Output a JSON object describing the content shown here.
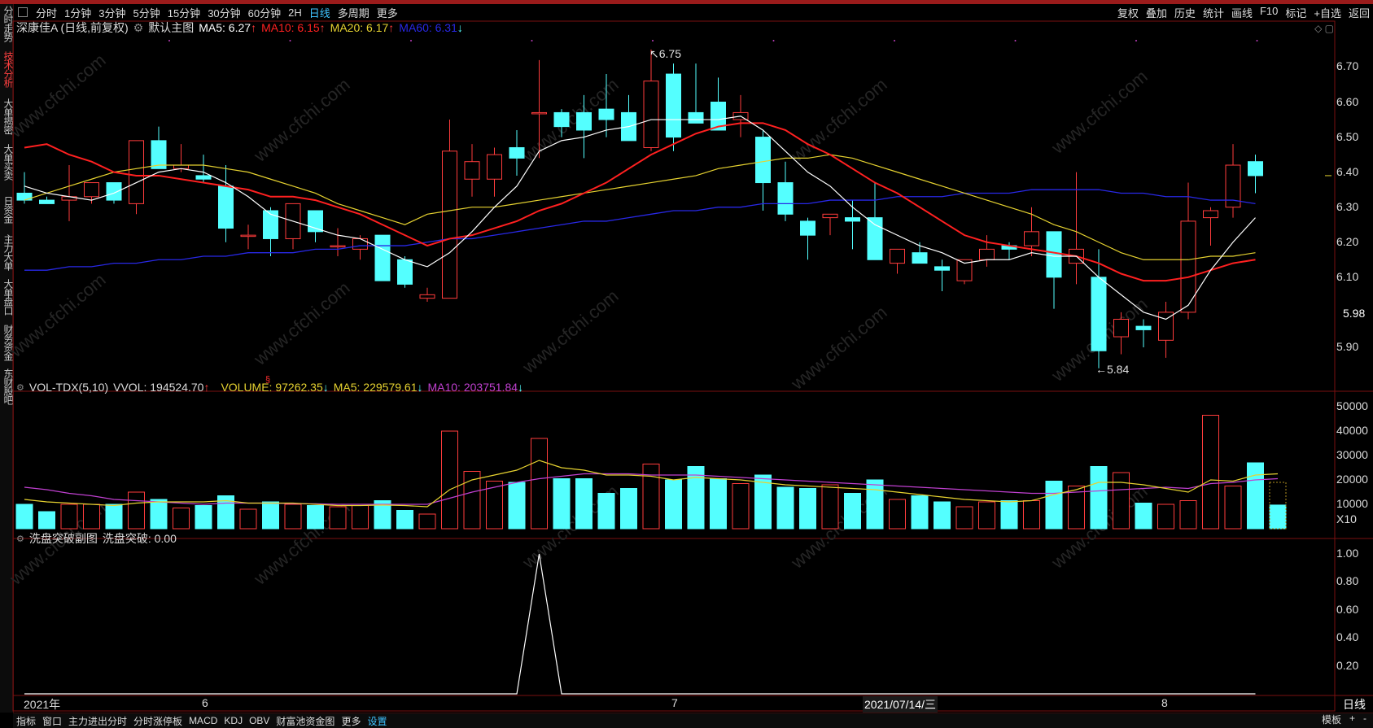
{
  "period_tabs": [
    "分时",
    "1分钟",
    "3分钟",
    "5分钟",
    "15分钟",
    "30分钟",
    "60分钟",
    "2H",
    "日线",
    "多周期",
    "更多"
  ],
  "active_period": "日线",
  "toolbar": [
    "复权",
    "叠加",
    "历史",
    "统计",
    "画线",
    "F10",
    "标记",
    "+自选",
    "返回"
  ],
  "sidebar_tabs": [
    "分时走势",
    "技术分析",
    "大单揭密",
    "大单买卖",
    "日资金",
    "主力大单",
    "大单盘口",
    "财务资金",
    "东财股吧"
  ],
  "active_sidebar": "技术分析",
  "main_legend": {
    "stock": "深康佳A (日线,前复权)",
    "template": "默认主图",
    "ma5": "MA5: 6.27",
    "ma10": "MA10: 6.15",
    "ma20": "MA20: 6.17",
    "ma60": "MA60: 6.31"
  },
  "vol_legend": {
    "name": "VOL-TDX(5,10)",
    "vvol": "VVOL: 194524.70",
    "volume": "VOLUME: 97262.35",
    "ma5": "MA5: 229579.61",
    "ma10": "MA10: 203751.84"
  },
  "ind_legend": {
    "name": "洗盘突破副图",
    "value": "洗盘突破: 0.00"
  },
  "price_axis": [
    "6.70",
    "6.60",
    "6.50",
    "6.40",
    "6.30",
    "6.20",
    "6.10",
    "5.90"
  ],
  "current_price": "5.98",
  "high_label": "6.75",
  "low_label": "5.84",
  "vol_axis": [
    "50000",
    "40000",
    "30000",
    "20000",
    "10000",
    "X10"
  ],
  "ind_axis": [
    "1.00",
    "0.80",
    "0.60",
    "0.40",
    "0.20"
  ],
  "dates": {
    "year": "2021年",
    "m6": "6",
    "m7": "7",
    "cursor": "2021/07/14/三",
    "m8": "8"
  },
  "period_corner": "日线",
  "bottom_tabs": [
    "指标",
    "窗口",
    "主力进出分时",
    "分时涨停板",
    "MACD",
    "KDJ",
    "OBV",
    "财富池资金图",
    "更多",
    "设置"
  ],
  "active_bottom": "设置",
  "bottom_right": [
    "模板",
    "+",
    "-"
  ],
  "watermark": "www.cfchi.com",
  "colors": {
    "up": "#ff3c3c",
    "down": "#54ffff",
    "ma5": "#ffffff",
    "ma10": "#ff2020",
    "ma20": "#e6d230",
    "ma60": "#2828e6",
    "vma10": "#c040d0"
  },
  "chart_data": {
    "type": "candlestick",
    "ylim": [
      5.8,
      6.78
    ],
    "candles": [
      {
        "o": 6.34,
        "h": 6.4,
        "l": 6.31,
        "c": 6.32
      },
      {
        "o": 6.32,
        "h": 6.33,
        "l": 6.31,
        "c": 6.31
      },
      {
        "o": 6.32,
        "h": 6.42,
        "l": 6.26,
        "c": 6.33
      },
      {
        "o": 6.33,
        "h": 6.37,
        "l": 6.31,
        "c": 6.37
      },
      {
        "o": 6.37,
        "h": 6.37,
        "l": 6.31,
        "c": 6.32
      },
      {
        "o": 6.31,
        "h": 6.45,
        "l": 6.28,
        "c": 6.49
      },
      {
        "o": 6.49,
        "h": 6.53,
        "l": 6.41,
        "c": 6.41
      },
      {
        "o": 6.41,
        "h": 6.48,
        "l": 6.4,
        "c": 6.42
      },
      {
        "o": 6.39,
        "h": 6.45,
        "l": 6.37,
        "c": 6.38
      },
      {
        "o": 6.36,
        "h": 6.42,
        "l": 6.2,
        "c": 6.24
      },
      {
        "o": 6.22,
        "h": 6.25,
        "l": 6.18,
        "c": 6.22
      },
      {
        "o": 6.29,
        "h": 6.3,
        "l": 6.16,
        "c": 6.21
      },
      {
        "o": 6.21,
        "h": 6.3,
        "l": 6.18,
        "c": 6.31
      },
      {
        "o": 6.29,
        "h": 6.29,
        "l": 6.2,
        "c": 6.23
      },
      {
        "o": 6.19,
        "h": 6.24,
        "l": 6.16,
        "c": 6.19
      },
      {
        "o": 6.18,
        "h": 6.22,
        "l": 6.15,
        "c": 6.21
      },
      {
        "o": 6.22,
        "h": 6.22,
        "l": 6.09,
        "c": 6.09
      },
      {
        "o": 6.15,
        "h": 6.16,
        "l": 6.07,
        "c": 6.08
      },
      {
        "o": 6.04,
        "h": 6.07,
        "l": 6.03,
        "c": 6.05
      },
      {
        "o": 6.04,
        "h": 6.55,
        "l": 6.04,
        "c": 6.46
      },
      {
        "o": 6.38,
        "h": 6.48,
        "l": 6.33,
        "c": 6.43
      },
      {
        "o": 6.38,
        "h": 6.47,
        "l": 6.33,
        "c": 6.45
      },
      {
        "o": 6.47,
        "h": 6.52,
        "l": 6.39,
        "c": 6.44
      },
      {
        "o": 6.57,
        "h": 6.72,
        "l": 6.44,
        "c": 6.57
      },
      {
        "o": 6.57,
        "h": 6.58,
        "l": 6.5,
        "c": 6.53
      },
      {
        "o": 6.57,
        "h": 6.62,
        "l": 6.44,
        "c": 6.52
      },
      {
        "o": 6.58,
        "h": 6.68,
        "l": 6.5,
        "c": 6.55
      },
      {
        "o": 6.57,
        "h": 6.62,
        "l": 6.52,
        "c": 6.49
      },
      {
        "o": 6.47,
        "h": 6.75,
        "l": 6.46,
        "c": 6.66
      },
      {
        "o": 6.68,
        "h": 6.71,
        "l": 6.46,
        "c": 6.5
      },
      {
        "o": 6.57,
        "h": 6.71,
        "l": 6.56,
        "c": 6.54
      },
      {
        "o": 6.6,
        "h": 6.67,
        "l": 6.52,
        "c": 6.52
      },
      {
        "o": 6.55,
        "h": 6.62,
        "l": 6.5,
        "c": 6.57
      },
      {
        "o": 6.5,
        "h": 6.52,
        "l": 6.29,
        "c": 6.37
      },
      {
        "o": 6.37,
        "h": 6.43,
        "l": 6.26,
        "c": 6.28
      },
      {
        "o": 6.26,
        "h": 6.27,
        "l": 6.15,
        "c": 6.22
      },
      {
        "o": 6.27,
        "h": 6.27,
        "l": 6.22,
        "c": 6.28
      },
      {
        "o": 6.27,
        "h": 6.32,
        "l": 6.18,
        "c": 6.26
      },
      {
        "o": 6.27,
        "h": 6.37,
        "l": 6.15,
        "c": 6.15
      },
      {
        "o": 6.14,
        "h": 6.17,
        "l": 6.11,
        "c": 6.18
      },
      {
        "o": 6.17,
        "h": 6.2,
        "l": 6.14,
        "c": 6.14
      },
      {
        "o": 6.13,
        "h": 6.15,
        "l": 6.06,
        "c": 6.12
      },
      {
        "o": 6.09,
        "h": 6.15,
        "l": 6.08,
        "c": 6.15
      },
      {
        "o": 6.15,
        "h": 6.22,
        "l": 6.13,
        "c": 6.18
      },
      {
        "o": 6.19,
        "h": 6.2,
        "l": 6.15,
        "c": 6.18
      },
      {
        "o": 6.19,
        "h": 6.3,
        "l": 6.16,
        "c": 6.23
      },
      {
        "o": 6.23,
        "h": 6.23,
        "l": 6.01,
        "c": 6.1
      },
      {
        "o": 6.14,
        "h": 6.4,
        "l": 6.08,
        "c": 6.18
      },
      {
        "o": 6.1,
        "h": 6.18,
        "l": 5.84,
        "c": 5.89
      },
      {
        "o": 5.93,
        "h": 6.0,
        "l": 5.88,
        "c": 5.98
      },
      {
        "o": 5.96,
        "h": 5.98,
        "l": 5.9,
        "c": 5.95
      },
      {
        "o": 5.92,
        "h": 6.03,
        "l": 5.87,
        "c": 6.0
      },
      {
        "o": 6.0,
        "h": 6.37,
        "l": 5.98,
        "c": 6.26
      },
      {
        "o": 6.27,
        "h": 6.3,
        "l": 6.19,
        "c": 6.29
      },
      {
        "o": 6.3,
        "h": 6.48,
        "l": 6.27,
        "c": 6.42
      },
      {
        "o": 6.43,
        "h": 6.45,
        "l": 6.34,
        "c": 6.39
      }
    ],
    "ma5": [
      6.36,
      6.34,
      6.33,
      6.32,
      6.34,
      6.37,
      6.4,
      6.41,
      6.4,
      6.37,
      6.33,
      6.28,
      6.26,
      6.24,
      6.22,
      6.21,
      6.18,
      6.15,
      6.13,
      6.17,
      6.23,
      6.3,
      6.36,
      6.46,
      6.49,
      6.5,
      6.52,
      6.53,
      6.55,
      6.55,
      6.55,
      6.55,
      6.56,
      6.52,
      6.46,
      6.4,
      6.36,
      6.3,
      6.25,
      6.22,
      6.19,
      6.17,
      6.14,
      6.15,
      6.15,
      6.17,
      6.16,
      6.16,
      6.1,
      6.05,
      6.0,
      5.98,
      6.02,
      6.12,
      6.2,
      6.27
    ],
    "ma10": [
      6.47,
      6.48,
      6.45,
      6.43,
      6.4,
      6.39,
      6.39,
      6.38,
      6.37,
      6.36,
      6.35,
      6.33,
      6.33,
      6.32,
      6.3,
      6.28,
      6.25,
      6.22,
      6.19,
      6.21,
      6.22,
      6.24,
      6.26,
      6.29,
      6.31,
      6.34,
      6.37,
      6.41,
      6.45,
      6.48,
      6.51,
      6.53,
      6.54,
      6.54,
      6.52,
      6.48,
      6.45,
      6.41,
      6.37,
      6.34,
      6.3,
      6.26,
      6.22,
      6.2,
      6.19,
      6.18,
      6.17,
      6.16,
      6.14,
      6.11,
      6.09,
      6.09,
      6.1,
      6.12,
      6.14,
      6.15
    ],
    "ma20": [
      6.32,
      6.34,
      6.36,
      6.38,
      6.4,
      6.41,
      6.42,
      6.42,
      6.42,
      6.41,
      6.4,
      6.38,
      6.36,
      6.34,
      6.31,
      6.29,
      6.27,
      6.25,
      6.28,
      6.29,
      6.3,
      6.3,
      6.31,
      6.32,
      6.33,
      6.34,
      6.35,
      6.36,
      6.37,
      6.38,
      6.39,
      6.41,
      6.42,
      6.43,
      6.44,
      6.44,
      6.45,
      6.44,
      6.42,
      6.4,
      6.38,
      6.36,
      6.34,
      6.32,
      6.3,
      6.28,
      6.25,
      6.23,
      6.2,
      6.17,
      6.15,
      6.15,
      6.15,
      6.16,
      6.16,
      6.17
    ],
    "ma60": [
      6.12,
      6.12,
      6.13,
      6.13,
      6.14,
      6.14,
      6.15,
      6.15,
      6.16,
      6.16,
      6.17,
      6.17,
      6.17,
      6.18,
      6.18,
      6.19,
      6.19,
      6.19,
      6.2,
      6.21,
      6.21,
      6.22,
      6.23,
      6.24,
      6.25,
      6.26,
      6.26,
      6.27,
      6.28,
      6.29,
      6.29,
      6.3,
      6.3,
      6.31,
      6.31,
      6.31,
      6.32,
      6.32,
      6.32,
      6.33,
      6.33,
      6.33,
      6.34,
      6.34,
      6.34,
      6.35,
      6.35,
      6.35,
      6.35,
      6.34,
      6.34,
      6.33,
      6.33,
      6.32,
      6.32,
      6.31
    ],
    "volume": [
      10000,
      7000,
      10000,
      10000,
      10000,
      15000,
      12000,
      8500,
      9500,
      13500,
      8000,
      11000,
      10000,
      9500,
      9000,
      9500,
      11500,
      7500,
      6000,
      40000,
      23500,
      19500,
      19000,
      37000,
      20500,
      20500,
      14500,
      16500,
      26500,
      20000,
      25500,
      20500,
      18500,
      22000,
      17000,
      16500,
      18000,
      14500,
      20000,
      12000,
      13500,
      11000,
      9000,
      11000,
      11500,
      11500,
      19500,
      17500,
      25500,
      23000,
      10500,
      10000,
      11500,
      46500,
      17500,
      27000,
      9700
    ],
    "vol_ma5": [
      12000,
      11000,
      10500,
      10000,
      9500,
      10500,
      11000,
      11000,
      11000,
      11500,
      10500,
      10500,
      10500,
      10000,
      9500,
      9500,
      9700,
      9500,
      9000,
      16000,
      20000,
      22000,
      24000,
      28000,
      25000,
      24000,
      22000,
      22000,
      21500,
      20000,
      21000,
      20500,
      20000,
      19000,
      18000,
      17500,
      17000,
      16500,
      16000,
      15000,
      14000,
      13000,
      12000,
      11500,
      11000,
      11500,
      14000,
      16000,
      19000,
      19000,
      18000,
      16500,
      15000,
      20000,
      19500,
      22000,
      22500
    ],
    "vol_ma10": [
      17000,
      16000,
      14500,
      13500,
      12000,
      11500,
      11000,
      10500,
      10000,
      10500,
      10500,
      10500,
      10300,
      10200,
      10000,
      10000,
      10000,
      10000,
      10000,
      12500,
      15000,
      17000,
      19000,
      20500,
      21500,
      22500,
      22500,
      22500,
      22000,
      22000,
      22000,
      21500,
      21000,
      20500,
      20000,
      19500,
      19000,
      18500,
      18000,
      17500,
      17000,
      16500,
      16000,
      15500,
      15000,
      14500,
      14500,
      15000,
      15500,
      16000,
      16500,
      17000,
      16500,
      18500,
      19000,
      20000,
      20500
    ],
    "indicator": {
      "spike_index": 23,
      "values_peak": 1.0
    }
  }
}
